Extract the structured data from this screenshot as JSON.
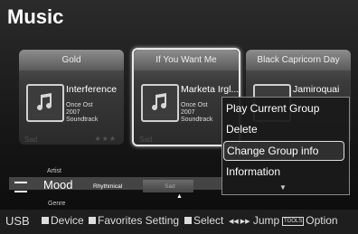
{
  "app": {
    "title": "Music"
  },
  "cards": [
    {
      "header": "Gold",
      "title": "Interference",
      "meta": [
        "Once Ost",
        "2007",
        "Soundtrack"
      ],
      "dim_label": "Sad",
      "stars": "★★★",
      "selected": false
    },
    {
      "header": "If You Want Me",
      "title": "Marketa Irgl...",
      "meta": [
        "Once Ost",
        "2007",
        "Soundtrack"
      ],
      "dim_label": "Sad",
      "selected": true
    },
    {
      "header": "Black Capricorn Day",
      "title": "Jamiroquai",
      "selected": false
    }
  ],
  "mood_bar": {
    "above": "Artist",
    "current": "Mood",
    "below": "Genre",
    "options": [
      "Rhythmical",
      "Sad"
    ],
    "up_arrow": "▲"
  },
  "menu": {
    "items": [
      "Play Current Group",
      "Delete",
      "Change Group info",
      "Information"
    ],
    "active_index": 2,
    "more_arrow": "▼"
  },
  "footer": {
    "source": "USB",
    "device": "Device",
    "favorites": "Favorites Setting",
    "select": "Select",
    "jump_arrows": "◀◀ ▶▶",
    "jump": "Jump",
    "tools": "TOOLS",
    "option": "Option"
  },
  "icons": {
    "music_note": "music-note-icon"
  }
}
